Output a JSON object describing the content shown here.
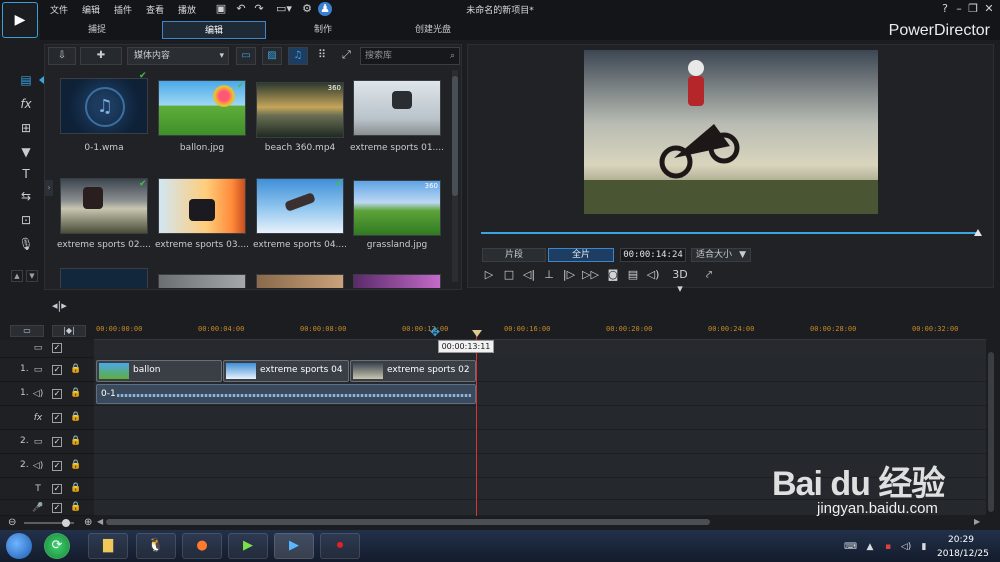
{
  "window": {
    "title": "未命名的新项目*"
  },
  "menu": [
    "文件",
    "编辑",
    "插件",
    "查看",
    "播放"
  ],
  "modes": [
    "捕捉",
    "编辑",
    "制作",
    "创建光盘"
  ],
  "brand": "PowerDirector",
  "library": {
    "media_filter": "媒体内容",
    "search_placeholder": "搜索库",
    "items": [
      {
        "label": "0-1.wma",
        "type": "audio",
        "checked": true
      },
      {
        "label": "ballon.jpg",
        "type": "image",
        "checked": true
      },
      {
        "label": "beach 360.mp4",
        "type": "video",
        "badge": "360",
        "checked": false
      },
      {
        "label": "extreme sports 01....",
        "type": "image",
        "checked": false
      },
      {
        "label": "extreme sports 02....",
        "type": "image",
        "checked": true
      },
      {
        "label": "extreme sports 03....",
        "type": "image",
        "checked": false
      },
      {
        "label": "extreme sports 04....",
        "type": "image",
        "checked": true
      },
      {
        "label": "grassland.jpg",
        "type": "image",
        "badge": "360",
        "checked": false
      }
    ]
  },
  "preview": {
    "mode_clip": "片段",
    "mode_movie": "全片",
    "timecode": "00:00:14:24",
    "fit": "适合大小",
    "three_d": "3D",
    "progress": 1.0
  },
  "timeline": {
    "ticks": [
      "00:00:00:00",
      "00:00:04:00",
      "00:00:08:00",
      "00:00:12:00",
      "00:00:16:00",
      "00:00:20:00",
      "00:00:24:00",
      "00:00:28:00",
      "00:00:32:00"
    ],
    "tooltip": "00:00:13:11",
    "tracks": [
      {
        "num": "",
        "icon": "▭"
      },
      {
        "num": "1.",
        "icon": "▭"
      },
      {
        "num": "1.",
        "icon": "◁)"
      },
      {
        "num": "",
        "icon": "fx"
      },
      {
        "num": "2.",
        "icon": "▭"
      },
      {
        "num": "2.",
        "icon": "◁)"
      },
      {
        "num": "",
        "icon": "T"
      },
      {
        "num": "",
        "icon": "🎤"
      }
    ],
    "video_clips": [
      "ballon",
      "extreme sports 04",
      "extreme sports 02"
    ],
    "audio_clip": "0-1"
  },
  "taskbar": {
    "time": "20:29",
    "date": "2018/12/25"
  },
  "watermark": {
    "main": "Bai du 经验",
    "sub": "jingyan.baidu.com"
  },
  "colors": {
    "accent": "#3aa3e0",
    "playhead": "#d8343a",
    "ruler_text": "#c98a25"
  }
}
